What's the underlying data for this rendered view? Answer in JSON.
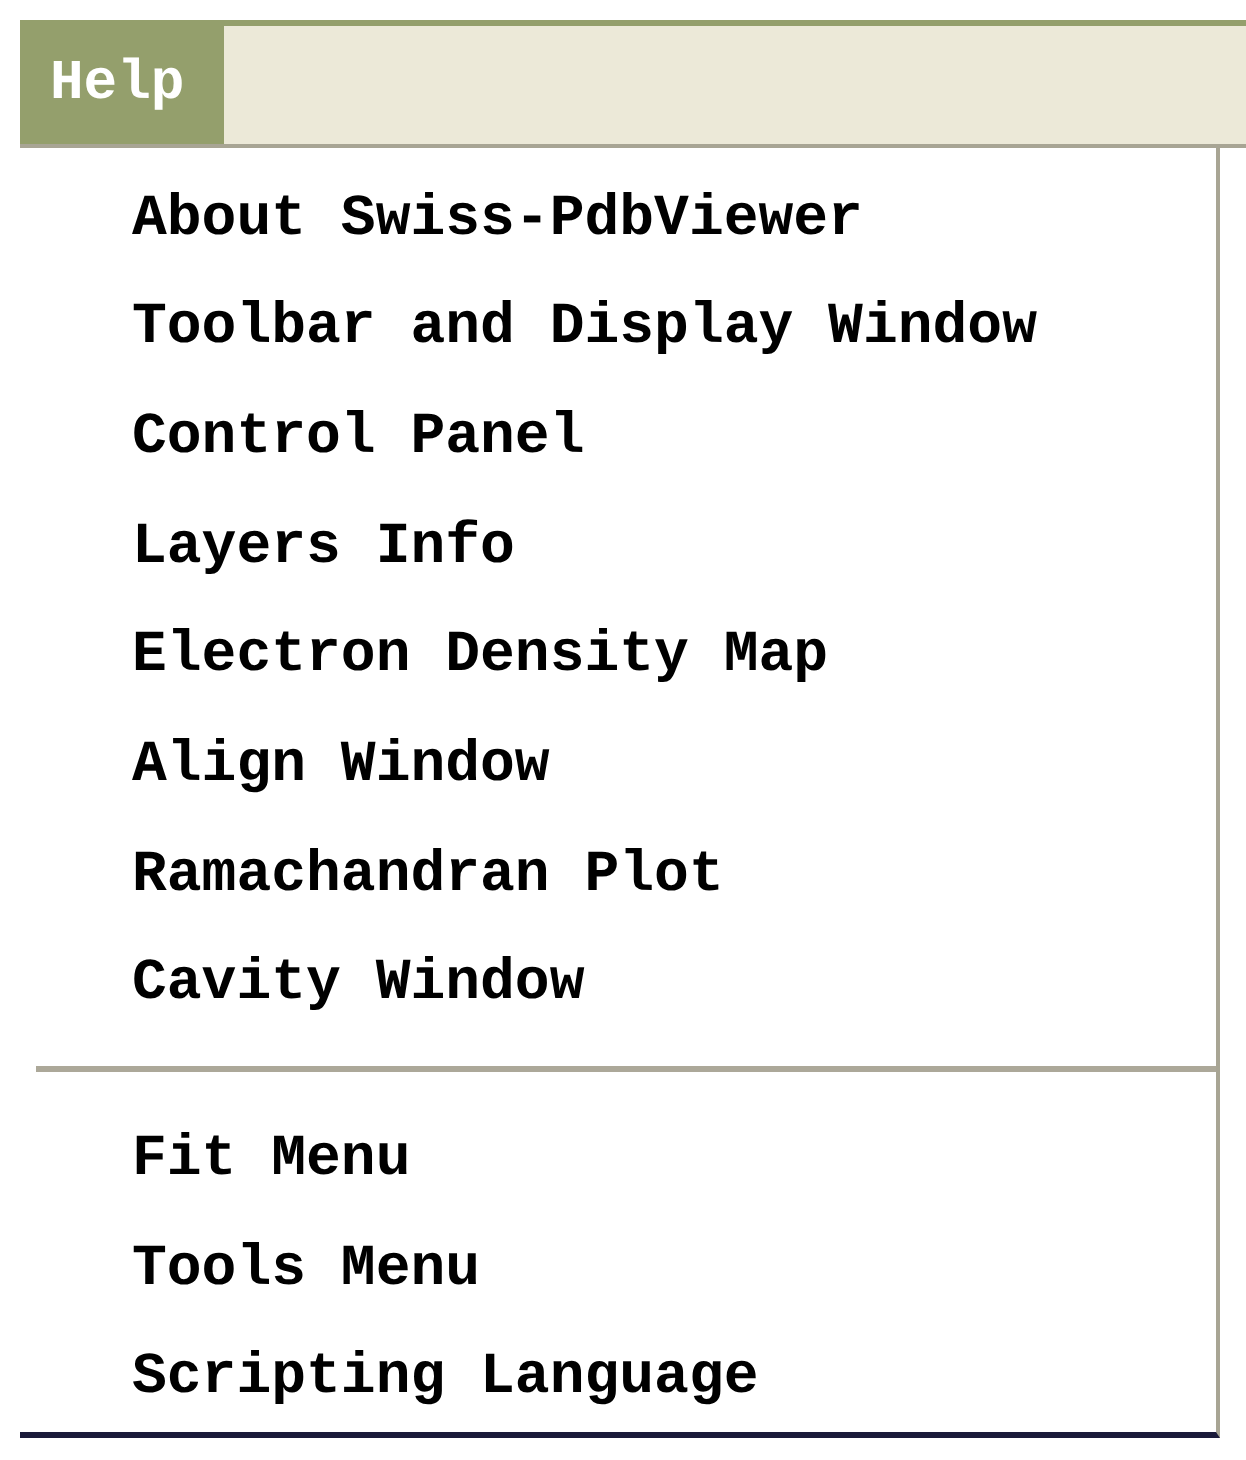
{
  "menu_bar": [
    {
      "label": "Help",
      "selected": true
    }
  ],
  "menu": [
    {
      "kind": "item",
      "label": "About Swiss-PdbViewer"
    },
    {
      "kind": "item",
      "label": "Toolbar and Display Window"
    },
    {
      "kind": "item",
      "label": "Control Panel"
    },
    {
      "kind": "item",
      "label": "Layers Info"
    },
    {
      "kind": "item",
      "label": "Electron Density Map"
    },
    {
      "kind": "item",
      "label": "Align Window"
    },
    {
      "kind": "item",
      "label": "Ramachandran Plot"
    },
    {
      "kind": "item",
      "label": "Cavity Window"
    },
    {
      "kind": "separator"
    },
    {
      "kind": "item",
      "label": "Fit Menu"
    },
    {
      "kind": "item",
      "label": "Tools Menu"
    },
    {
      "kind": "item",
      "label": "Scripting Language"
    }
  ]
}
